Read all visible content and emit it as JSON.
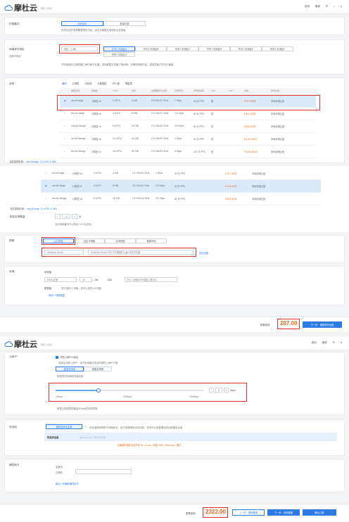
{
  "top1": {
    "brand": "摩杜云",
    "region": "地区 | 北京",
    "nav": [
      "费用",
      "备案",
      "",
      "",
      "",
      ""
    ]
  },
  "billing": {
    "label": "付费模式",
    "options": [
      "包年包月",
      "按量付费"
    ],
    "note": "包年包月的资源需要预先付费，适合长期稳定使用的业务场景。"
  },
  "region": {
    "label": "地域及可用区",
    "sub": "选择可用区",
    "region_value": "地区（上海）",
    "zones": [
      "华东1 可用区A",
      "华东1 可用区B",
      "华东1 可用区C",
      "华东1 可用区D",
      "华东1 可用区E",
      "华东1 可用区F",
      "华东1 可用区G"
    ],
    "note": "不同地域的云服务器之间内网不互通；选择最靠近您客户的地域，可降低网络时延、提高您客户的访问速度。"
  },
  "spec": {
    "label": "实例",
    "filter_tabs": [
      "通用",
      "计算型",
      "内存型",
      "大数据型",
      "GPU型",
      "裸金属"
    ],
    "headers": [
      "",
      "规格名称",
      "规格族",
      "vCPU",
      "内存",
      "处理器型号/主频",
      "内网带宽",
      "内网收发包",
      "IPv6",
      "GPU",
      "价格",
      "参考价格"
    ],
    "rows": [
      {
        "name": "ecs.c6.large",
        "family": "计算型 c6",
        "vcpu": "2 vCPU",
        "mem": "4 GiB",
        "cpu": "2.5 GHz/3.2 GHz",
        "bw": "1 Gbps",
        "pps": "30 万 PPS",
        "ipv6": "是",
        "price": "¥ 207.00/月",
        "ref": "本地存储云盘"
      },
      {
        "name": "ecs.c6.xlarge",
        "family": "计算型 c6",
        "vcpu": "4 vCPU",
        "mem": "8 GiB",
        "cpu": "2.5 GHz/3.2 GHz",
        "bw": "1.5 Gbps",
        "pps": "50 万 PPS",
        "ipv6": "是",
        "price": "¥ 414.00/月",
        "ref": "本地存储云盘"
      },
      {
        "name": "ecs.c6.2xlarge",
        "family": "计算型 c6",
        "vcpu": "8 vCPU",
        "mem": "16 GiB",
        "cpu": "2.5 GHz/3.2 GHz",
        "bw": "2.5 Gbps",
        "pps": "80 万 PPS",
        "ipv6": "是",
        "price": "¥ 828.00/月",
        "ref": "本地存储云盘"
      },
      {
        "name": "ecs.c6.3xlarge",
        "family": "计算型 c6",
        "vcpu": "12 vCPU",
        "mem": "24 GiB",
        "cpu": "2.5 GHz/3.2 GHz",
        "bw": "4 Gbps",
        "pps": "90 万 PPS",
        "ipv6": "是",
        "price": "¥ 1242.00/月",
        "ref": "本地存储云盘"
      },
      {
        "name": "ecs.c6.4xlarge",
        "family": "计算型 c6",
        "vcpu": "16 vCPU",
        "mem": "32 GiB",
        "cpu": "2.5 GHz/3.2 GHz",
        "bw": "5 Gbps",
        "pps": "100 万 PPS",
        "ipv6": "是",
        "price": "¥ 1656.00/月",
        "ref": "本地存储云盘"
      }
    ],
    "selected_label": "当前选择实例：",
    "selected_value": "ecs.c6.large（2 vCPU 4 GiB）"
  },
  "spec2": {
    "rows": [
      {
        "name": "ecs.c6.large",
        "family": "计算型 c6",
        "vcpu": "2 vCPU",
        "mem": "4 GiB",
        "cpu": "2.5 GHz/3.2 GHz",
        "bw": "1 Gbps",
        "pps": "30 万 PPS",
        "price": "¥ 207.00/月",
        "ref": "本地存储云盘"
      },
      {
        "name": "ecs.c6.xlarge",
        "family": "计算型 c6",
        "vcpu": "4 vCPU",
        "mem": "8 GiB",
        "cpu": "2.5 GHz/3.2 GHz",
        "bw": "1.5 Gbps",
        "pps": "50 万 PPS",
        "price": "¥ 414.00/月",
        "ref": "本地存储云盘"
      },
      {
        "name": "ecs.c6.2xlarge",
        "family": "计算型 c6",
        "vcpu": "8 vCPU",
        "mem": "16 GiB",
        "cpu": "2.5 GHz/3.2 GHz",
        "bw": "2.5 Gbps",
        "pps": "80 万 PPS",
        "price": "¥ 828.00/月",
        "ref": "本地存储云盘"
      }
    ],
    "selected_label": "当前选择实例：",
    "selected_value": "ecs.c6.large（2 vCPU 4 GiB）",
    "qty_label": "购买实例数量",
    "qty": "1",
    "qty_unit": "台",
    "qty_note": "当前地域最多可以购买 100 台实例。"
  },
  "image": {
    "label": "镜像",
    "tabs": [
      "公共镜像",
      "自定义镜像",
      "共享镜像",
      "镜像市场"
    ],
    "os": "Windows Server",
    "version": "Windows Server 2012 R2 数据中心版 64位中文版",
    "security": "安全加固"
  },
  "storage": {
    "label": "存储",
    "sub": "系统盘",
    "disk_type": "ESSD云盘",
    "size": "40",
    "unit": "GiB",
    "iops": "2280",
    "perf": "PL0（单盘IOPS性能上限1万）",
    "data_label": "数据盘",
    "data_note": "您已选择 0 块盘，还可以选择 16 块盘",
    "add": "增加一块数据盘"
  },
  "order1": {
    "label": "配置费用:",
    "price": "207.00",
    "next": "下一步：网络和安全组"
  },
  "top2": {
    "brand": "摩杜云",
    "region": "地区 | 北京",
    "nav": [
      "费用",
      "备案",
      "",
      "",
      ""
    ]
  },
  "network": {
    "label": "公网 IP",
    "checkbox": "分配公网IPv4地址",
    "checkbox_note": "系统会分配公网IP，也可采用更加灵活的弹性公网IP方案",
    "tabs": [
      "按使用流量",
      "按固定带宽"
    ],
    "tip": "带宽按实际使用流量收费",
    "slider_marks": [
      "1Mbps",
      "50Mbps",
      "100Mbps"
    ],
    "value": "0",
    "unit": "Mbps",
    "note": "阿里云免费提供最高5Gbps的内网带宽"
  },
  "secgroup": {
    "label": "安全组",
    "button": "重新选择安全组",
    "note": "安全组规则有助于网络安全，用于设置网络访问控制。您也可以到管理控制台新建安全组",
    "selected": "所选安全组",
    "selected_value": "sg-xxxxxxxx / 默认安全组",
    "ports": "请确保所选安全组开放 22（Linux）或者 3389（Windows）端口"
  },
  "eni": {
    "label": "弹性网卡",
    "sub": "主网卡",
    "vswitch": "交换机",
    "add": "增加一块辅助弹性网卡"
  },
  "order2": {
    "label": "配置费用:",
    "price": "2322.00",
    "prev": "上一步：基础配置",
    "next": "下一步：系统配置",
    "confirm": "确认订单"
  }
}
